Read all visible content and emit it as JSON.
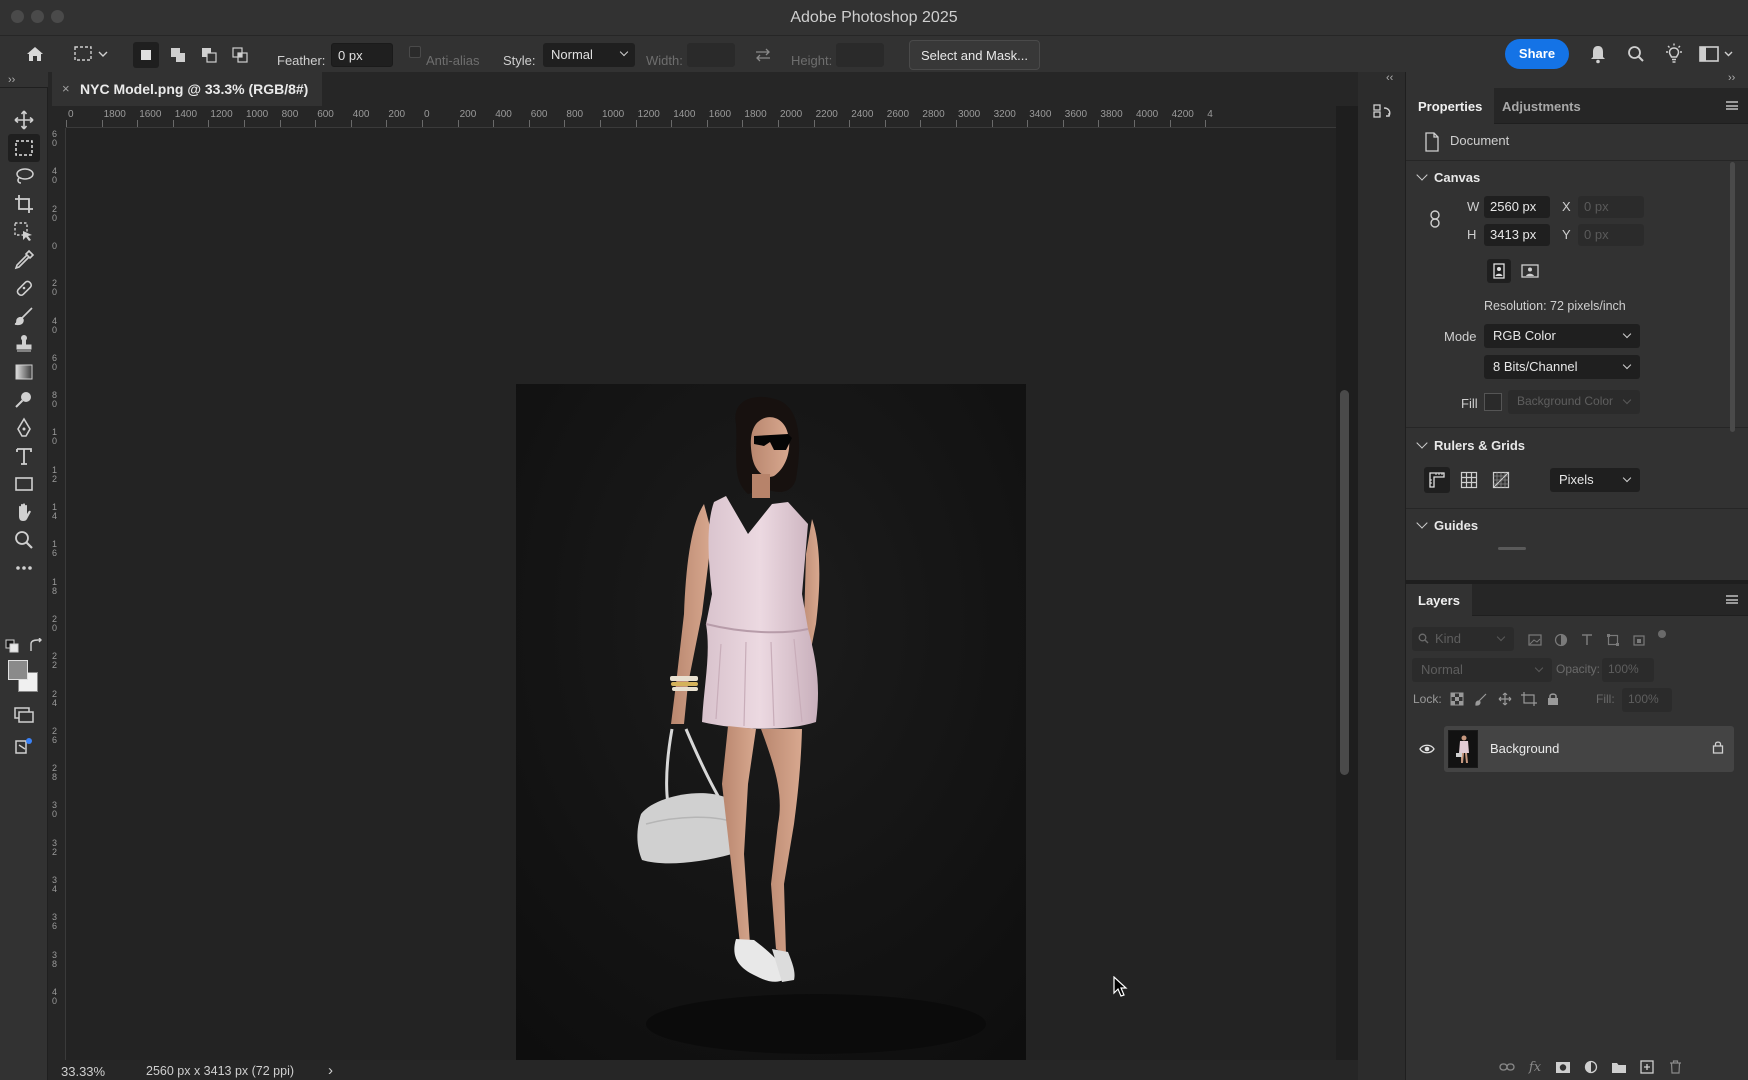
{
  "app_title": "Adobe Photoshop 2025",
  "options_bar": {
    "feather_label": "Feather:",
    "feather_value": "0 px",
    "antialias_label": "Anti-alias",
    "style_label": "Style:",
    "style_value": "Normal",
    "width_label": "Width:",
    "height_label": "Height:",
    "select_mask_label": "Select and Mask...",
    "share_label": "Share"
  },
  "document": {
    "tab_title": "NYC Model.png @ 33.3% (RGB/8#)",
    "close_glyph": "×",
    "zoom": "33.33%",
    "size_info": "2560 px x 3413 px (72 ppi)",
    "status_arrow": "›"
  },
  "ruler_top_labels": [
    "0",
    "1800",
    "1600",
    "1400",
    "1200",
    "1000",
    "800",
    "600",
    "400",
    "200",
    "0",
    "200",
    "400",
    "600",
    "800",
    "1000",
    "1200",
    "1400",
    "1600",
    "1800",
    "2000",
    "2200",
    "2400",
    "2600",
    "2800",
    "3000",
    "3200",
    "3400",
    "3600",
    "3800",
    "4000",
    "4200",
    "4"
  ],
  "ruler_left_labels": [
    "6\n0",
    "4\n0",
    "2\n0",
    "0",
    "2\n0",
    "4\n0",
    "6\n0",
    "8\n0",
    "1\n0",
    "1\n2",
    "1\n4",
    "1\n6",
    "1\n8",
    "2\n0",
    "2\n2",
    "2\n4",
    "2\n6",
    "2\n8",
    "3\n0",
    "3\n2",
    "3\n4",
    "3\n6",
    "3\n8",
    "4\n0"
  ],
  "properties": {
    "tab_properties": "Properties",
    "tab_adjustments": "Adjustments",
    "document_label": "Document",
    "canvas_section": "Canvas",
    "w_label": "W",
    "w_value": "2560 px",
    "h_label": "H",
    "h_value": "3413 px",
    "x_label": "X",
    "x_value": "0 px",
    "y_label": "Y",
    "y_value": "0 px",
    "resolution": "Resolution: 72 pixels/inch",
    "mode_label": "Mode",
    "mode_value": "RGB Color",
    "bits_value": "8 Bits/Channel",
    "fill_label": "Fill",
    "fill_value": "Background Color",
    "rulers_section": "Rulers & Grids",
    "units_value": "Pixels",
    "guides_section": "Guides"
  },
  "layers": {
    "title": "Layers",
    "kind_placeholder": "Kind",
    "blend_value": "Normal",
    "opacity_label": "Opacity:",
    "opacity_value": "100%",
    "lock_label": "Lock:",
    "fill_label": "Fill:",
    "fill_value": "100%",
    "layer_name": "Background"
  },
  "colors": {
    "accent": "#1473e6",
    "panel": "#323232",
    "canvas": "#232323"
  }
}
